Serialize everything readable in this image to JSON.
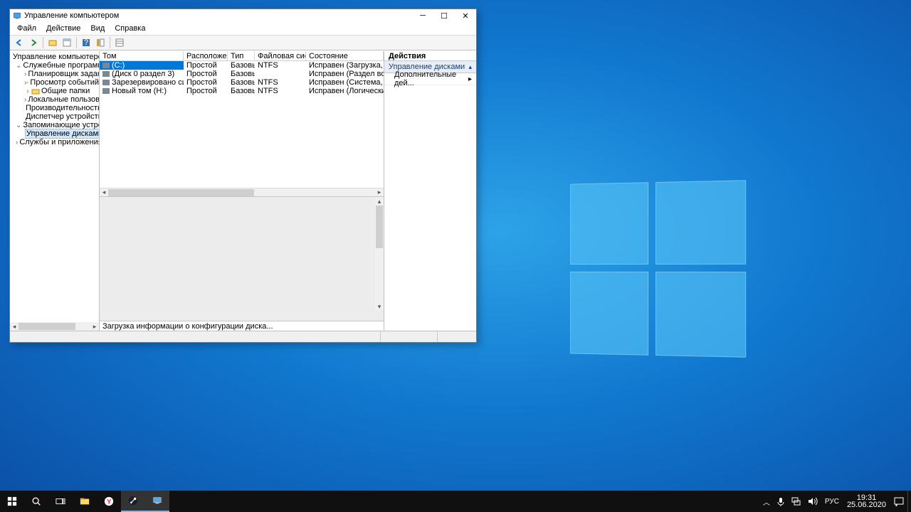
{
  "window": {
    "title": "Управление компьютером",
    "menu": [
      "Файл",
      "Действие",
      "Вид",
      "Справка"
    ]
  },
  "tree": {
    "root": "Управление компьютером (л",
    "groups": [
      {
        "label": "Служебные программы",
        "children": [
          "Планировщик заданий",
          "Просмотр событий",
          "Общие папки",
          "Локальные пользоват",
          "Производительность",
          "Диспетчер устройств"
        ]
      },
      {
        "label": "Запоминающие устройст",
        "children": [
          "Управление дисками"
        ]
      },
      {
        "label": "Службы и приложения",
        "children": []
      }
    ],
    "selected": "Управление дисками"
  },
  "columns": {
    "c0": "Том",
    "c1": "Расположение",
    "c2": "Тип",
    "c3": "Файловая система",
    "c4": "Состояние"
  },
  "volumes": [
    {
      "vol": "(C:)",
      "layout": "Простой",
      "type": "Базовый",
      "fs": "NTFS",
      "status": "Исправен (Загрузка, Файл"
    },
    {
      "vol": "(Диск 0 раздел 3)",
      "layout": "Простой",
      "type": "Базовый",
      "fs": "",
      "status": "Исправен (Раздел восстан"
    },
    {
      "vol": "Зарезервировано системой",
      "layout": "Простой",
      "type": "Базовый",
      "fs": "NTFS",
      "status": "Исправен (Система, Акти"
    },
    {
      "vol": "Новый том (H:)",
      "layout": "Простой",
      "type": "Базовый",
      "fs": "NTFS",
      "status": "Исправен (Логический ди"
    }
  ],
  "status_text": "Загрузка информации о конфигурации диска...",
  "actions": {
    "header": "Действия",
    "section": "Управление дисками",
    "item": "Дополнительные дей..."
  },
  "tray": {
    "lang": "РУС",
    "time": "19:31",
    "date": "25.06.2020"
  }
}
